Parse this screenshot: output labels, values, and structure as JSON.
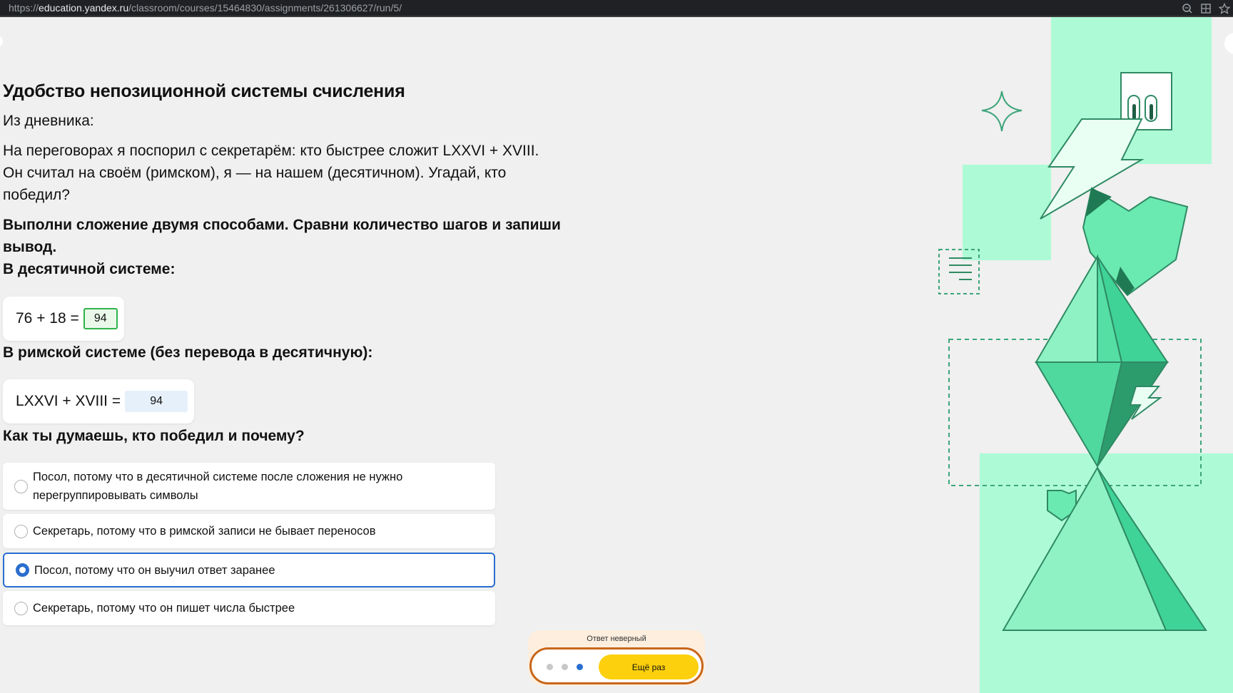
{
  "browser": {
    "url_scheme": "https://",
    "url_host": "education.yandex.ru",
    "url_path": "/classroom/courses/15464830/assignments/261306627/run/5/",
    "tools": [
      "zoom-icon",
      "apps-icon",
      "star-icon"
    ]
  },
  "task": {
    "title": "Удобство непозиционной системы счисления",
    "intro": "Из дневника:",
    "story_line1": "На переговорах я поспорил с секретарём: кто быстрее сложит LXXVI + XVIII.",
    "story_line2": "Он считал на своём (римском), я — на нашем (десятичном). Угадай, кто",
    "story_line3": "победил?",
    "instruction_line1": "Выполни сложение двумя способами. Сравни количество шагов и запиши",
    "instruction_line2": "вывод.",
    "decimal_heading": "В десятичной системе:",
    "decimal_expr": "76 + 18 =",
    "decimal_answer": "94",
    "roman_heading": "В римской системе (без перевода в десятичную):",
    "roman_expr": "LXXVI + XVIII =",
    "roman_answer": "94",
    "question": "Как ты думаешь, кто победил и почему?",
    "options": [
      {
        "line1": "Посол, потому что в десятичной системе после сложения не нужно",
        "line2": "перегруппировывать символы",
        "selected": false
      },
      {
        "line1": "Секретарь, потому что в римской записи не бывает переносов",
        "selected": false
      },
      {
        "line1": "Посол, потому что он выучил ответ заранее",
        "selected": true
      },
      {
        "line1": "Секретарь, потому что он пишет числа быстрее",
        "selected": false
      }
    ]
  },
  "feedback": {
    "status": "Ответ неверный",
    "retry_label": "Ещё раз",
    "attempts_total": 3,
    "current_attempt": 3
  },
  "colors": {
    "accent_blue": "#2a6ecf",
    "correct_green": "#2fb34a",
    "button_yellow": "#fcd00c",
    "error_orange": "#c8661a",
    "mint": "#adfbd6",
    "mint_dark": "#3fd397"
  }
}
